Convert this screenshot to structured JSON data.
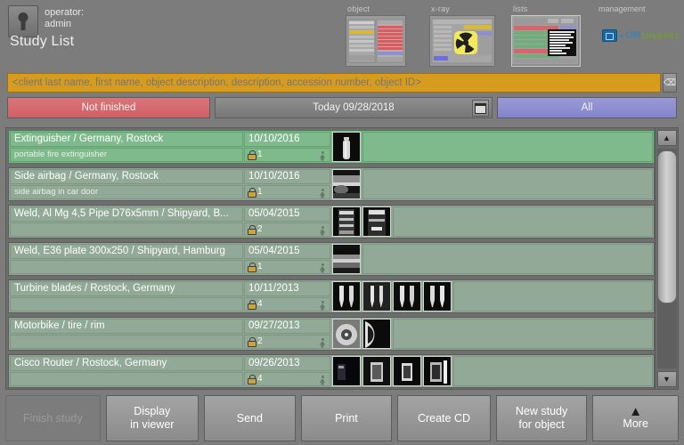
{
  "header": {
    "operator_label": "operator:",
    "operator_name": "admin",
    "page_title": "Study List",
    "operator_icon": "key-icon",
    "tiles": [
      {
        "label": "object",
        "icon": "object-preview-thumbnail"
      },
      {
        "label": "x-ray",
        "icon": "xray-preview-thumbnail"
      },
      {
        "label": "lists",
        "icon": "lists-preview-thumbnail"
      }
    ],
    "management_label": "management",
    "brand_name_prefix": "OR",
    "brand_name_suffix": "inspect",
    "brand_color": "#3f82b4",
    "brand_accent_color": "#6f9e36"
  },
  "search": {
    "placeholder": "<client last name, first name, object description, description, accession number, object ID>",
    "value": "",
    "background_color": "#d79b1e",
    "button_icon": "clear-icon",
    "button_label": "⌫"
  },
  "filters": [
    {
      "label": "Not finished",
      "state": "active",
      "color": "#cf6066",
      "name": "filter-not-finished"
    },
    {
      "label": "Today 09/28/2018",
      "state": "inactive",
      "color": "#777777",
      "name": "filter-today",
      "calendar_icon": "calendar-icon"
    },
    {
      "label": "All",
      "state": "inactive",
      "color": "#8484cb",
      "name": "filter-all"
    }
  ],
  "list": {
    "selected_row_color": "#7cb489",
    "row_color": "#8fa794",
    "rows": [
      {
        "name": "Extinguisher / Germany, Rostock",
        "date": "10/10/2016",
        "description": "portable fire extinguisher",
        "image_count": "1",
        "selected": true,
        "thumbnails": [
          "extinguisher-xray"
        ]
      },
      {
        "name": "Side airbag / Germany, Rostock",
        "date": "10/10/2016",
        "description": "side airbag in car door",
        "image_count": "1",
        "selected": false,
        "thumbnails": [
          "airbag-xray"
        ]
      },
      {
        "name": "Weld, Al Mg 4,5 Pipe D76x5mm / Shipyard, B...",
        "date": "05/04/2015",
        "description": "",
        "image_count": "2",
        "selected": false,
        "thumbnails": [
          "weld-pipe-xray-1",
          "weld-pipe-xray-2"
        ]
      },
      {
        "name": "Weld, E36 plate 300x250 / Shipyard, Hamburg",
        "date": "05/04/2015",
        "description": "",
        "image_count": "1",
        "selected": false,
        "thumbnails": [
          "weld-plate-xray"
        ]
      },
      {
        "name": "Turbine blades / Rostock, Germany",
        "date": "10/11/2013",
        "description": "",
        "image_count": "4",
        "selected": false,
        "thumbnails": [
          "turbine-blade-1",
          "turbine-blade-2",
          "turbine-blade-3",
          "turbine-blade-4"
        ]
      },
      {
        "name": "Motorbike / tire / rim",
        "date": "09/27/2013",
        "description": "",
        "image_count": "2",
        "selected": false,
        "thumbnails": [
          "motorbike-tire",
          "motorbike-rim"
        ]
      },
      {
        "name": "Cisco Router / Rostock, Germany",
        "date": "09/26/2013",
        "description": "",
        "image_count": "4",
        "selected": false,
        "thumbnails": [
          "router-xray-1",
          "router-xray-2",
          "router-xray-3",
          "router-xray-4"
        ]
      }
    ],
    "scrollbar": {
      "up_arrow": "▲",
      "down_arrow": "▼"
    }
  },
  "toolbar": {
    "finish_study": "Finish study",
    "display_in_viewer_line1": "Display",
    "display_in_viewer_line2": "in viewer",
    "send": "Send",
    "print": "Print",
    "create_cd": "Create CD",
    "new_study_line1": "New study",
    "new_study_line2": "for object",
    "more": "More",
    "more_icon": "chevron-up-double-icon"
  }
}
